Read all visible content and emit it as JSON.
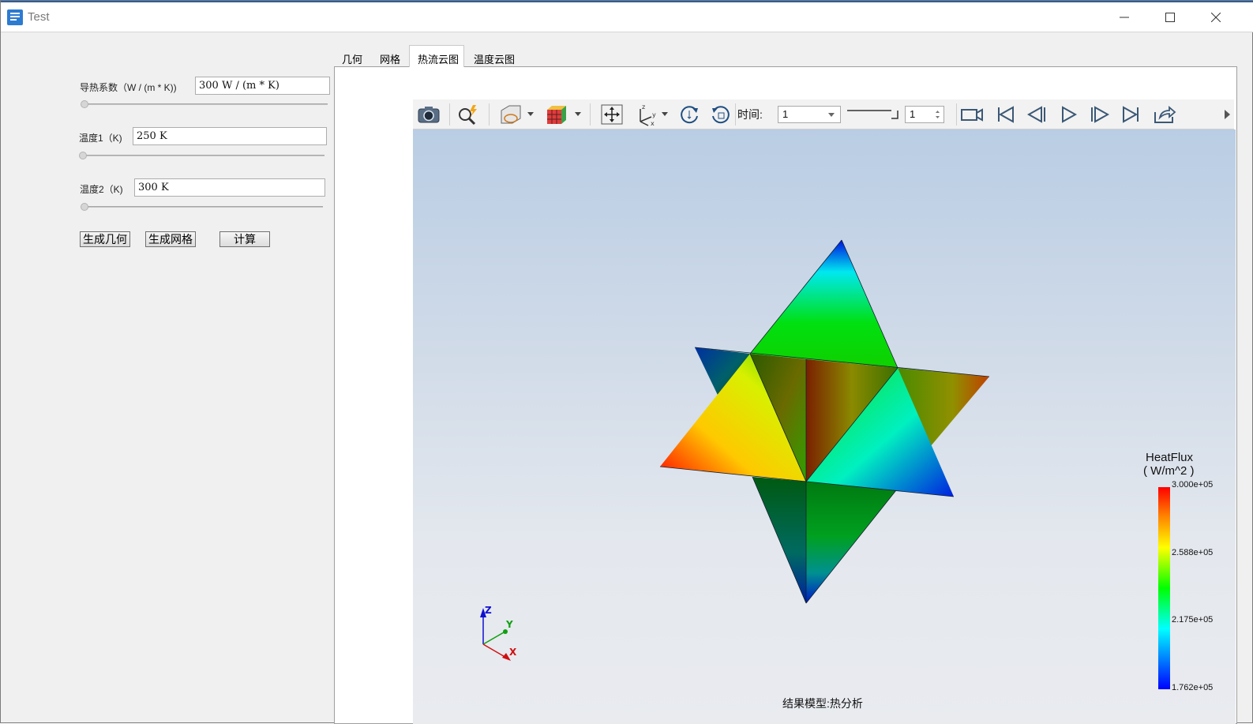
{
  "window": {
    "title": "Test"
  },
  "params": {
    "conductivity": {
      "label": "导热系数（W / (m * K))",
      "value": "300 W / (m * K)"
    },
    "temp1": {
      "label": "温度1（K)",
      "value": "250 K"
    },
    "temp2": {
      "label": "温度2（K)",
      "value": "300 K"
    }
  },
  "buttons": {
    "gen_geometry": "生成几何",
    "gen_mesh": "生成网格",
    "compute": "计算"
  },
  "tabs": [
    {
      "label": "几何"
    },
    {
      "label": "网格"
    },
    {
      "label": "热流云图"
    },
    {
      "label": "温度云图"
    }
  ],
  "active_tab": "热流云图",
  "toolbar": {
    "time_label": "时间:",
    "time_value": "1",
    "step_value": "1"
  },
  "legend": {
    "title": "HeatFlux",
    "unit": "( W/m^2 )",
    "ticks": [
      "3.000e+05",
      "2.588e+05",
      "2.175e+05",
      "1.762e+05"
    ]
  },
  "axes": {
    "x": "X",
    "y": "Y",
    "z": "Z"
  },
  "model_label": "结果模型:热分析",
  "colors": {
    "accent": "#2c5f9e",
    "window_bg": "#f0f0f0"
  }
}
